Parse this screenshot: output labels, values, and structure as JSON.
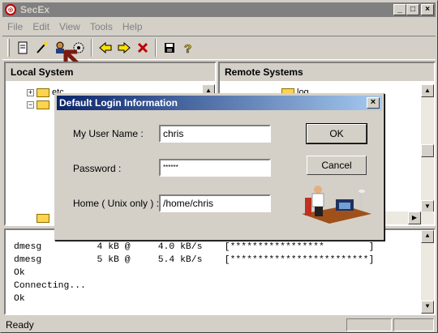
{
  "window": {
    "title": "SecEx",
    "app_icon": "SecEx-app-icon"
  },
  "title_buttons": {
    "minimize": "_",
    "maximize": "□",
    "close": "×"
  },
  "menu": [
    "File",
    "Edit",
    "View",
    "Tools",
    "Help"
  ],
  "toolbar": {
    "icons": [
      "document-icon",
      "wand-icon",
      "user-login-icon",
      "settings-gear-icon",
      "back-arrow-icon",
      "forward-arrow-icon",
      "delete-x-icon",
      "save-disk-icon",
      "help-question-icon"
    ]
  },
  "left_pane": {
    "title": "Local System",
    "tree": [
      {
        "label": "etc",
        "expander": "+"
      },
      {
        "label": "",
        "expander": "−"
      }
    ]
  },
  "right_pane": {
    "title": "Remote Systems",
    "tree": [
      {
        "label": "log",
        "expander": ""
      }
    ]
  },
  "console_lines": [
    "dmesg          4 kB @     4.0 kB/s    [*****************        ]",
    "dmesg          5 kB @     5.4 kB/s    [*************************]",
    "Ok",
    "Connecting...",
    "Ok"
  ],
  "status": {
    "text": "Ready"
  },
  "dialog": {
    "title": "Default Login Information",
    "close_label": "×",
    "username_label": "My User Name :",
    "username_value": "chris",
    "password_label": "Password :",
    "password_value": "******",
    "home_label": "Home ( Unix only ) :",
    "home_value": "/home/chris",
    "ok_label": "OK",
    "cancel_label": "Cancel",
    "illustration": "person-at-computer-icon"
  },
  "colors": {
    "accent": "#0a246a",
    "annotation_arrow": "#7a1a10"
  }
}
